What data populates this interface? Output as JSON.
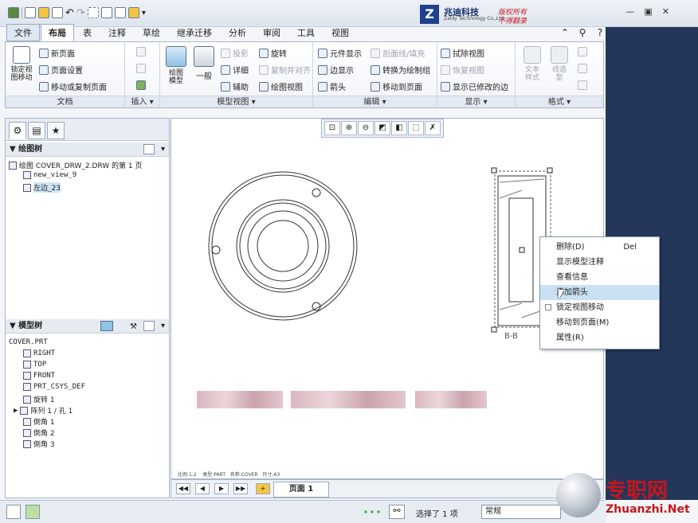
{
  "menu_tabs": [
    "文件",
    "布局",
    "表",
    "注释",
    "草绘",
    "继承迁移",
    "分析",
    "审阅",
    "工具",
    "视图"
  ],
  "ribbon": {
    "doc": {
      "lock_view_move": "锁定视\n图移动",
      "new_page": "新页面",
      "page_setup": "页面设置",
      "move_copy_page": "移动或复制页面",
      "label": "文档"
    },
    "insert": {
      "label": "插入"
    },
    "model_view": {
      "drawing_model": "绘图\n模型",
      "general": "一般",
      "projection": "投影",
      "detail": "详细",
      "auxiliary": "辅助",
      "rotate": "旋转",
      "copy_align": "复制并对齐",
      "drawing_view": "绘图视图",
      "label": "模型视图"
    },
    "edit": {
      "element_display": "元件显示",
      "edge_display": "边显示",
      "arrow": "箭头",
      "section_line_fill": "剖面线/填充",
      "convert_to_draft": "转换为绘制组",
      "move_to_page": "移动到页面",
      "label": "编辑"
    },
    "display": {
      "erase_view": "拭除视图",
      "restore_view": "恢复视图",
      "show_modified_edges": "显示已修改的边",
      "label": "显示"
    },
    "format": {
      "text_style": "文本\n样式",
      "line_style": "线造\n型",
      "label": "格式"
    }
  },
  "logo": {
    "brand": "兆迪科技",
    "english": "Zaldy Technology Co.,Ltd.",
    "right1": "版权所有",
    "right2": "不得翻录"
  },
  "drawing_tree": {
    "title": "绘图树",
    "items": [
      "绘图 COVER_DRW_2.DRW 的第 1 页",
      "new_view_9",
      "左边_23"
    ]
  },
  "model_tree": {
    "title": "模型树",
    "root": "COVER.PRT",
    "items": [
      "RIGHT",
      "TOP",
      "FRONT",
      "PRT_CSYS_DEF",
      "旋转 1",
      "阵列 1 / 孔 1",
      "倒角 1",
      "倒角 2",
      "倒角 3"
    ]
  },
  "canvas": {
    "section_label": "B-B",
    "footer_text": "比例:1:2    类型:PART   名称:COVER   尺寸:A3"
  },
  "page_tab": "页面 1",
  "context_menu": [
    {
      "label": "删除(D)",
      "shortcut": "Del"
    },
    {
      "label": "显示模型注释",
      "shortcut": ""
    },
    {
      "label": "查看信息",
      "shortcut": ""
    },
    {
      "label": "添加箭头",
      "shortcut": ""
    },
    {
      "label": "锁定视图移动",
      "shortcut": ""
    },
    {
      "label": "移动到页面(M)",
      "shortcut": ""
    },
    {
      "label": "属性(R)",
      "shortcut": ""
    }
  ],
  "status": {
    "selected": "选择了 1 项",
    "filter": "常规"
  },
  "watermark": {
    "cn": "专职网",
    "url": "Zhuanzhi.Net"
  }
}
